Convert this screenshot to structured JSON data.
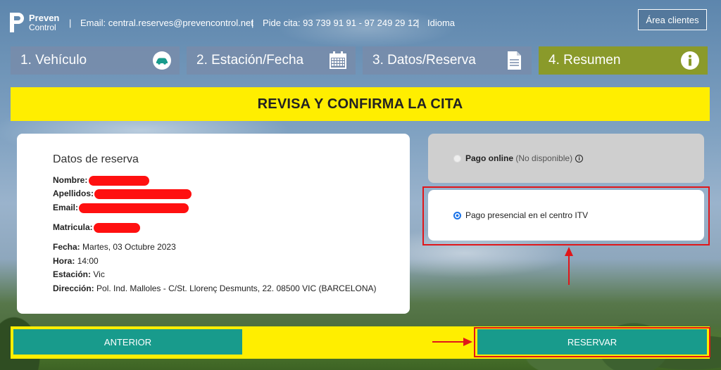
{
  "header": {
    "logo_line1": "Preven",
    "logo_line2": "Control",
    "email": "Email: central.reserves@prevencontrol.net",
    "phones": "Pide cita: 93 739 91 91 - 97 249 29 12",
    "language": "Idioma",
    "separator": "|",
    "area_clientes": "Área clientes"
  },
  "steps": [
    {
      "label": "1. Vehículo",
      "icon": "car-icon",
      "active": false
    },
    {
      "label": "2. Estación/Fecha",
      "icon": "calendar-icon",
      "active": false
    },
    {
      "label": "3. Datos/Reserva",
      "icon": "document-icon",
      "active": false
    },
    {
      "label": "4. Resumen",
      "icon": "info-icon",
      "active": true
    }
  ],
  "banner": "REVISA Y CONFIRMA LA CITA",
  "reserva": {
    "title": "Datos de reserva",
    "nombre_label": "Nombre:",
    "apellidos_label": "Apellidos:",
    "email_label": "Email:",
    "matricula_label": "Matricula:",
    "fecha_label": "Fecha:",
    "fecha_value": "Martes, 03 Octubre 2023",
    "hora_label": "Hora:",
    "hora_value": "14:00",
    "estacion_label": "Estación:",
    "estacion_value": "Vic",
    "direccion_label": "Dirección:",
    "direccion_value": "Pol. Ind. Malloles - C/St. Llorenç Desmunts, 22. 08500 VIC (BARCELONA)"
  },
  "payment": {
    "online_label": "Pago online",
    "online_note": "(No disponible)",
    "info_glyph": "i",
    "presencial_label": "Pago presencial en el centro ITV",
    "selected": "presencial"
  },
  "footer": {
    "anterior": "ANTERIOR",
    "reservar": "RESERVAR"
  },
  "colors": {
    "banner": "#ffee00",
    "button": "#189b8c",
    "active_step": "#8a9a2a",
    "annotation": "#e0161a",
    "redaction": "#ff1010"
  }
}
